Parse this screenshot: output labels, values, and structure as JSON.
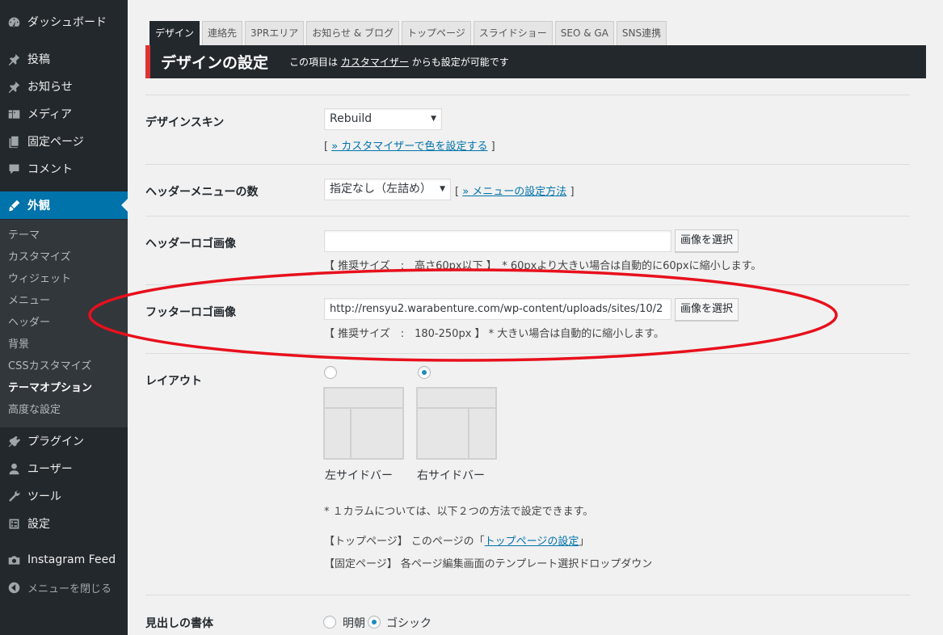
{
  "sidebar": {
    "items_top": [
      {
        "label": "ダッシュボード",
        "icon": "dashboard-icon"
      },
      {
        "label": "投稿",
        "icon": "pushpin-icon"
      },
      {
        "label": "お知らせ",
        "icon": "pushpin-icon"
      },
      {
        "label": "メディア",
        "icon": "media-icon"
      },
      {
        "label": "固定ページ",
        "icon": "page-icon"
      },
      {
        "label": "コメント",
        "icon": "comment-icon"
      },
      {
        "label": "外観",
        "icon": "paintbrush-icon"
      }
    ],
    "submenu": [
      "テーマ",
      "カスタマイズ",
      "ウィジェット",
      "メニュー",
      "ヘッダー",
      "背景",
      "CSSカスタマイズ",
      "テーマオプション",
      "高度な設定"
    ],
    "submenu_current_index": 7,
    "items_bottom": [
      {
        "label": "プラグイン",
        "icon": "plugin-icon"
      },
      {
        "label": "ユーザー",
        "icon": "user-icon"
      },
      {
        "label": "ツール",
        "icon": "wrench-icon"
      },
      {
        "label": "設定",
        "icon": "settings-icon"
      },
      {
        "label": "Instagram Feed",
        "icon": "camera-icon"
      },
      {
        "label": "メニューを閉じる",
        "icon": "collapse-icon"
      }
    ]
  },
  "tabs": [
    "デザイン",
    "連絡先",
    "3PRエリア",
    "お知らせ & ブログ",
    "トップページ",
    "スライドショー",
    "SEO & GA",
    "SNS連携"
  ],
  "active_tab_index": 0,
  "header": {
    "title": "デザインの設定",
    "sub_prefix": "この項目は",
    "sub_link": "カスタマイザー",
    "sub_suffix": "からも設定が可能です"
  },
  "design_skin": {
    "label": "デザインスキン",
    "value": "Rebuild",
    "link_open": "[",
    "link": "» カスタマイザーで色を設定する",
    "link_close": "]"
  },
  "header_menu": {
    "label": "ヘッダーメニューの数",
    "value": "指定なし（左詰め）",
    "link_open": "[",
    "link": "» メニューの設定方法",
    "link_close": "]"
  },
  "header_logo": {
    "label": "ヘッダーロゴ画像",
    "value": "",
    "button": "画像を選択",
    "note": "【 推奨サイズ　:　高さ60px以下 】　* 60pxより大きい場合は自動的に60pxに縮小します。"
  },
  "footer_logo": {
    "label": "フッターロゴ画像",
    "value": "http://rensyu2.warabenture.com/wp-content/uploads/sites/10/2",
    "button": "画像を選択",
    "note": "【 推奨サイズ　:　180-250px 】 * 大きい場合は自動的に縮小します。"
  },
  "layout": {
    "label": "レイアウト",
    "options": [
      "左サイドバー",
      "右サイドバー"
    ],
    "selected_index": 1,
    "note1": "* １カラムについては、以下２つの方法で設定できます。",
    "note2_prefix": "【トップページ】 このページの「",
    "note2_link": "トップページの設定",
    "note2_suffix": "」",
    "note3": "【固定ページ】 各ページ編集画面のテンプレート選択ドロップダウン"
  },
  "heading_font": {
    "label": "見出しの書体",
    "options": [
      "明朝",
      "ゴシック"
    ],
    "selected_index": 1
  },
  "colors": {
    "sidebar_bg": "#23282d",
    "active_blue": "#0073aa",
    "header_accent": "#dd3333",
    "annotation_red": "#e8101c"
  }
}
